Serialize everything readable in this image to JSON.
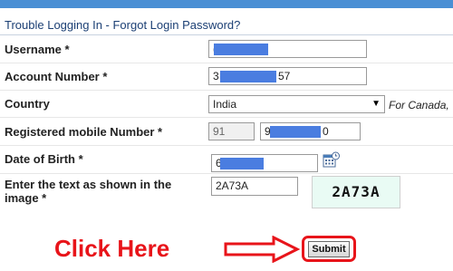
{
  "form": {
    "title": "Trouble Logging In - Forgot Login Password?",
    "username": {
      "label": "Username *",
      "value": "("
    },
    "account_number": {
      "label": "Account Number *",
      "value_start": "3",
      "value_end": "57"
    },
    "country": {
      "label": "Country",
      "selected": "India",
      "note": "For Canada,",
      "dropdown_arrow": "▼"
    },
    "mobile": {
      "label": "Registered mobile Number *",
      "country_code": "91",
      "number_start": "9",
      "number_end": "0"
    },
    "dob": {
      "label": "Date of Birth *",
      "value": "6"
    },
    "captcha": {
      "label": "Enter the text as shown in the image *",
      "value": "2A73A",
      "image_text": "2A73A"
    },
    "submit_label": "Submit"
  },
  "annotation": {
    "text": "Click Here",
    "color": "#e8141a"
  },
  "colors": {
    "header_bar": "#4a8fd4",
    "title_text": "#1b3f74",
    "redaction": "#4a7de0",
    "captcha_bg": "#e9fbf4"
  },
  "icons": {
    "calendar": "calendar-icon",
    "arrow": "right-arrow-icon"
  }
}
